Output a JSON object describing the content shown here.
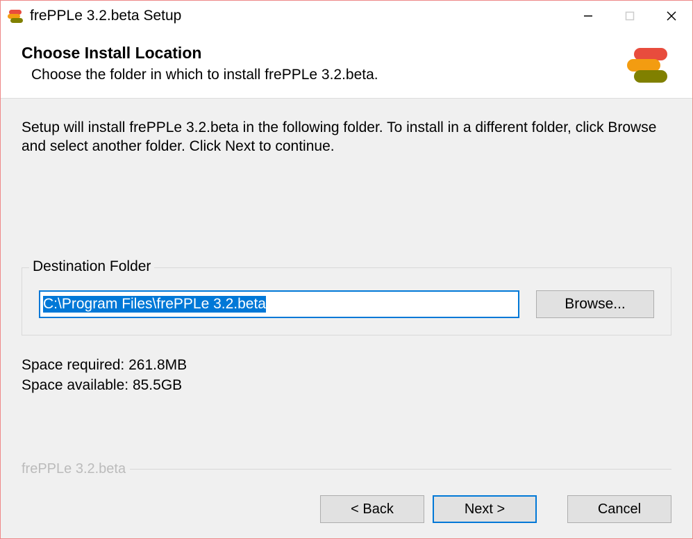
{
  "titlebar": {
    "title": "frePPLe 3.2.beta Setup"
  },
  "header": {
    "heading": "Choose Install Location",
    "sub": "Choose the folder in which to install frePPLe 3.2.beta."
  },
  "content": {
    "instructions": "Setup will install frePPLe 3.2.beta in the following folder. To install in a different folder, click Browse and select another folder. Click Next to continue.",
    "groupbox_label": "Destination Folder",
    "path_value": "C:\\Program Files\\frePPLe 3.2.beta",
    "browse_label": "Browse...",
    "space_required": "Space required: 261.8MB",
    "space_available": "Space available: 85.5GB"
  },
  "branding": "frePPLe 3.2.beta",
  "footer": {
    "back": "< Back",
    "next": "Next >",
    "cancel": "Cancel"
  },
  "colors": {
    "logo_red": "#e84c3d",
    "logo_orange": "#f39c11",
    "logo_green": "#808000"
  }
}
